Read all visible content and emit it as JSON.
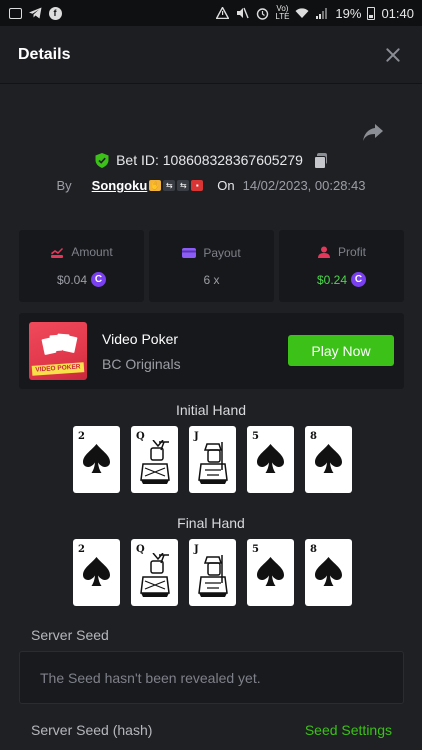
{
  "status_bar": {
    "battery": "19%",
    "time": "01:40",
    "network": "Vo)\nLTE"
  },
  "header": {
    "title": "Details"
  },
  "bet": {
    "id": "Bet ID: 108608328367605279",
    "by_label": "By",
    "username": "Songoku",
    "on_label": "On",
    "date": "14/02/2023, 00:28:43"
  },
  "stats": [
    {
      "label": "Amount",
      "value": "$0.04",
      "icon": "amount-icon",
      "color": "#e5375a"
    },
    {
      "label": "Payout",
      "value": "6 x",
      "icon": "payout-icon",
      "color": "#8b5cf6"
    },
    {
      "label": "Profit",
      "value": "$0.24",
      "icon": "profit-icon",
      "color": "#e5375a"
    }
  ],
  "coin_symbol": "C",
  "game": {
    "name": "Video Poker",
    "provider": "BC Originals",
    "thumb_label": "VIDEO POKER",
    "play_label": "Play Now"
  },
  "initial_hand": {
    "label": "Initial Hand",
    "cards": [
      "2",
      "Q",
      "J",
      "5",
      "8"
    ]
  },
  "final_hand": {
    "label": "Final Hand",
    "cards": [
      "2",
      "Q",
      "J",
      "5",
      "8"
    ]
  },
  "seeds": {
    "server_seed_label": "Server Seed",
    "server_seed_value": "The Seed hasn't been revealed yet.",
    "server_seed_hash_label": "Server Seed (hash)",
    "settings_link": "Seed Settings"
  },
  "colors": {
    "accent_green": "#3bc117",
    "profit_green": "#4ed44e",
    "coin_purple": "#7b3ff2"
  }
}
